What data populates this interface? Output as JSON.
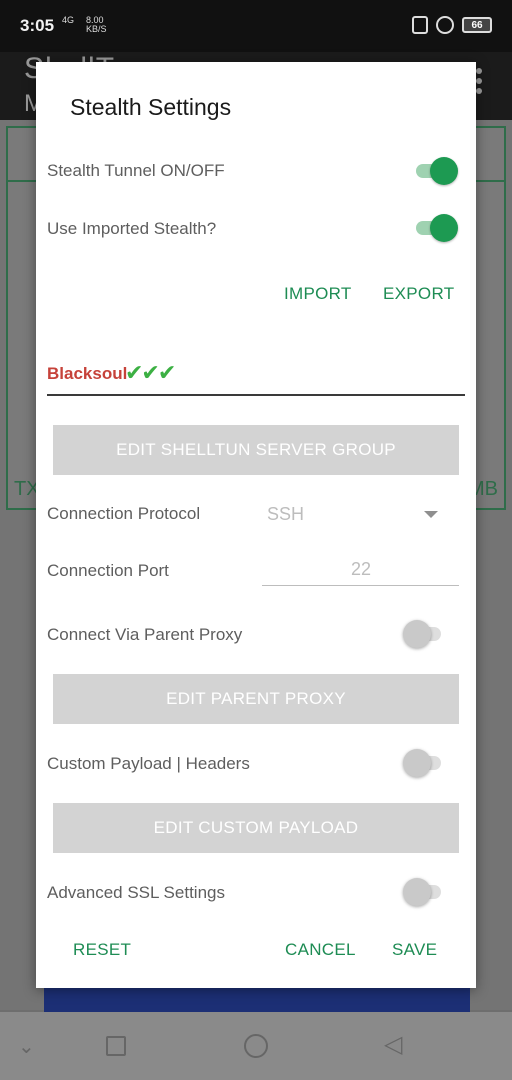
{
  "status_bar": {
    "time": "3:05",
    "network": "4G",
    "speed_value": "8.00",
    "speed_unit": "KB/S",
    "battery": "66"
  },
  "background_app": {
    "title": "ShellTun",
    "subtitle": "M",
    "tx_label": "TX",
    "mb_label": "MB"
  },
  "dialog": {
    "title": "Stealth Settings",
    "stealth_tunnel": {
      "label": "Stealth Tunnel ON/OFF",
      "on": true
    },
    "use_imported": {
      "label": "Use Imported Stealth?",
      "on": true
    },
    "import_label": "IMPORT",
    "export_label": "EXPORT",
    "stealth_name": "Blacksoul",
    "stealth_checks": "✔✔✔",
    "edit_server_group_label": "EDIT SHELLTUN SERVER GROUP",
    "connection_protocol": {
      "label": "Connection Protocol",
      "value": "SSH"
    },
    "connection_port": {
      "label": "Connection Port",
      "value": "22"
    },
    "parent_proxy": {
      "label": "Connect Via Parent Proxy",
      "on": false
    },
    "edit_parent_proxy_label": "EDIT PARENT PROXY",
    "custom_payload": {
      "label": "Custom Payload | Headers",
      "on": false
    },
    "edit_custom_payload_label": "EDIT CUSTOM PAYLOAD",
    "advanced_ssl": {
      "label": "Advanced SSL Settings",
      "on": false
    },
    "reset_label": "RESET",
    "cancel_label": "CANCEL",
    "save_label": "SAVE"
  },
  "colors": {
    "accent": "#1d9a52",
    "stealth_name": "#c6423a",
    "disabled_button": "#d3d3d3"
  }
}
